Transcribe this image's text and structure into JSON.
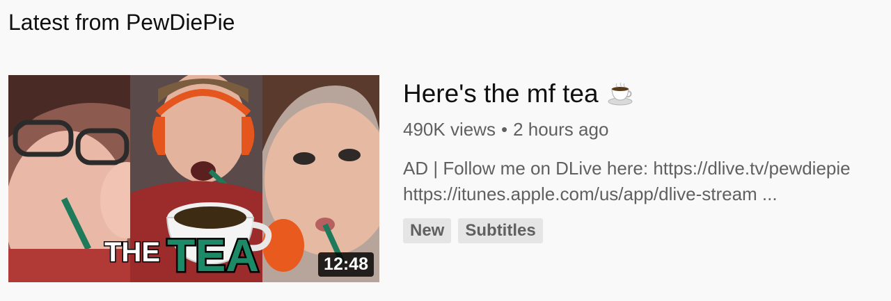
{
  "shelf": {
    "title": "Latest from PewDiePie"
  },
  "video": {
    "title": "Here's the mf tea",
    "title_icon": "coffee-cup-icon",
    "views": "490K views",
    "separator": "•",
    "age": "2 hours ago",
    "description_line1": "AD | Follow me on DLive here: https://dlive.tv/pewdiepie",
    "description_line2": "https://itunes.apple.com/us/app/dlive-stream ...",
    "duration": "12:48",
    "thumbnail_text": {
      "word1": "THE",
      "word2": "TEA"
    },
    "badges": [
      "New",
      "Subtitles"
    ]
  }
}
